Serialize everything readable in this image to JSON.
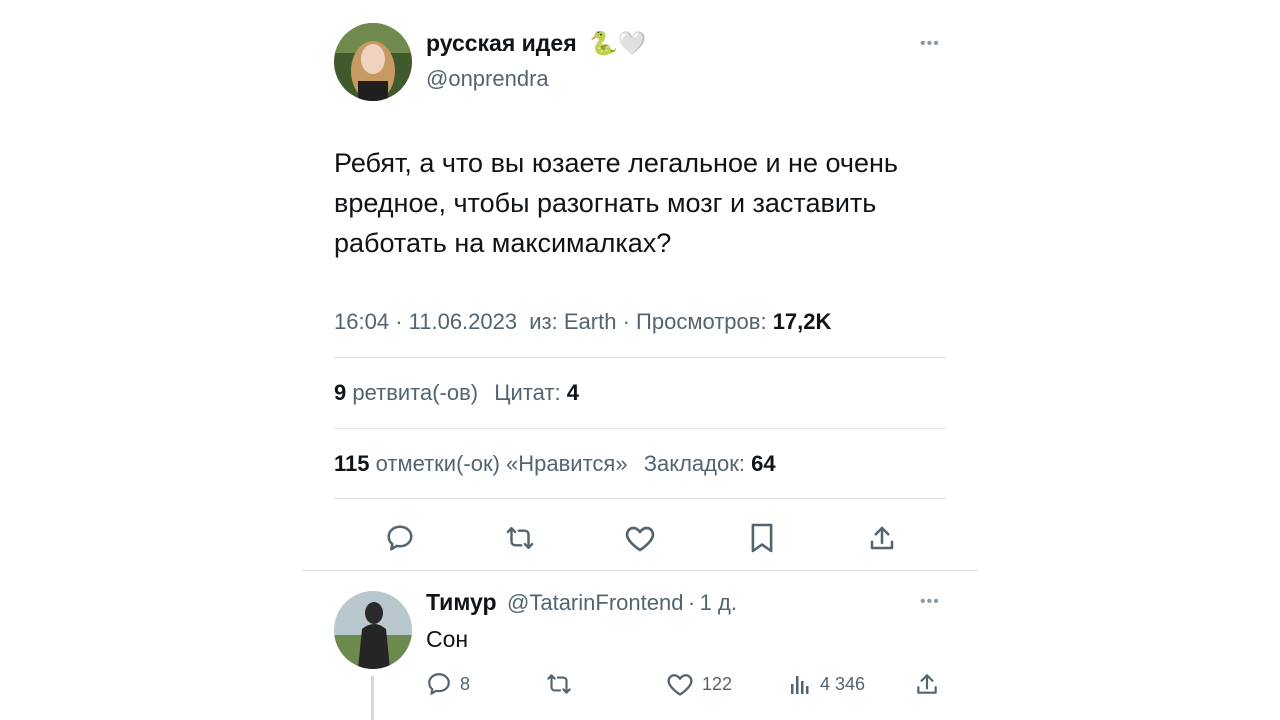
{
  "tweet": {
    "author_name": "русская идея",
    "author_emojis": "🐍🤍",
    "author_handle": "@onprendra",
    "text": "Ребят, а что вы юзаете легальное и не очень вредное, чтобы разогнать мозг и заставить работать на максималках?",
    "time": "16:04",
    "date": "11.06.2023",
    "source_prefix": "из:",
    "source": "Earth",
    "views_label": "Просмотров:",
    "views": "17,2K",
    "retweets_count": "9",
    "retweets_label": "ретвита(-ов)",
    "quotes_label": "Цитат:",
    "quotes_count": "4",
    "likes_count": "115",
    "likes_label": "отметки(-ок) «Нравится»",
    "bookmarks_label": "Закладок:",
    "bookmarks_count": "64"
  },
  "actions": [
    "reply-icon",
    "retweet-icon",
    "like-icon",
    "bookmark-icon",
    "share-icon"
  ],
  "reply": {
    "author_name": "Тимур",
    "author_handle": "@TatarinFrontend",
    "time": "1 д.",
    "text": "Сон",
    "replies": "8",
    "likes": "122",
    "views": "4 346"
  },
  "colors": {
    "text": "#0f1419",
    "secondary": "#536471",
    "divider": "#e1e6ea"
  }
}
